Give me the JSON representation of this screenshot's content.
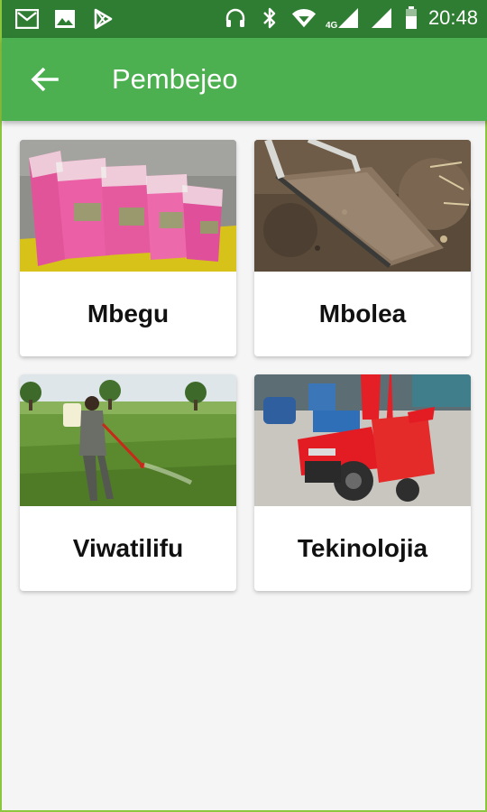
{
  "status_bar": {
    "time": "20:48",
    "network": "4G",
    "left_icons": [
      "gmail-icon",
      "image-icon",
      "play-store-icon"
    ],
    "right_icons": [
      "headset-icon",
      "bluetooth-icon",
      "wifi-icon",
      "signal-icon",
      "signal-icon",
      "battery-icon"
    ]
  },
  "app_bar": {
    "title": "Pembejeo",
    "back_icon": "arrow-back-icon",
    "color": "#4caf50"
  },
  "categories": [
    {
      "label": "Mbegu",
      "image": "seed-packets-image"
    },
    {
      "label": "Mbolea",
      "image": "soil-shovel-image"
    },
    {
      "label": "Viwatilifu",
      "image": "farmer-spraying-image"
    },
    {
      "label": "Tekinolojia",
      "image": "red-machine-image"
    }
  ]
}
